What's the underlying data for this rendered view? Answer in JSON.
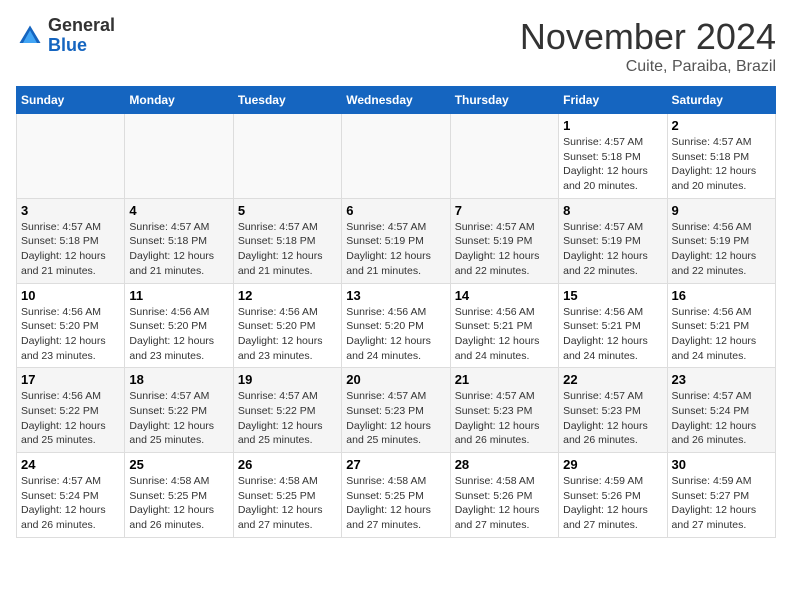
{
  "logo": {
    "general": "General",
    "blue": "Blue"
  },
  "header": {
    "month": "November 2024",
    "location": "Cuite, Paraiba, Brazil"
  },
  "weekdays": [
    "Sunday",
    "Monday",
    "Tuesday",
    "Wednesday",
    "Thursday",
    "Friday",
    "Saturday"
  ],
  "weeks": [
    [
      {
        "day": "",
        "info": ""
      },
      {
        "day": "",
        "info": ""
      },
      {
        "day": "",
        "info": ""
      },
      {
        "day": "",
        "info": ""
      },
      {
        "day": "",
        "info": ""
      },
      {
        "day": "1",
        "info": "Sunrise: 4:57 AM\nSunset: 5:18 PM\nDaylight: 12 hours\nand 20 minutes."
      },
      {
        "day": "2",
        "info": "Sunrise: 4:57 AM\nSunset: 5:18 PM\nDaylight: 12 hours\nand 20 minutes."
      }
    ],
    [
      {
        "day": "3",
        "info": "Sunrise: 4:57 AM\nSunset: 5:18 PM\nDaylight: 12 hours\nand 21 minutes."
      },
      {
        "day": "4",
        "info": "Sunrise: 4:57 AM\nSunset: 5:18 PM\nDaylight: 12 hours\nand 21 minutes."
      },
      {
        "day": "5",
        "info": "Sunrise: 4:57 AM\nSunset: 5:18 PM\nDaylight: 12 hours\nand 21 minutes."
      },
      {
        "day": "6",
        "info": "Sunrise: 4:57 AM\nSunset: 5:19 PM\nDaylight: 12 hours\nand 21 minutes."
      },
      {
        "day": "7",
        "info": "Sunrise: 4:57 AM\nSunset: 5:19 PM\nDaylight: 12 hours\nand 22 minutes."
      },
      {
        "day": "8",
        "info": "Sunrise: 4:57 AM\nSunset: 5:19 PM\nDaylight: 12 hours\nand 22 minutes."
      },
      {
        "day": "9",
        "info": "Sunrise: 4:56 AM\nSunset: 5:19 PM\nDaylight: 12 hours\nand 22 minutes."
      }
    ],
    [
      {
        "day": "10",
        "info": "Sunrise: 4:56 AM\nSunset: 5:20 PM\nDaylight: 12 hours\nand 23 minutes."
      },
      {
        "day": "11",
        "info": "Sunrise: 4:56 AM\nSunset: 5:20 PM\nDaylight: 12 hours\nand 23 minutes."
      },
      {
        "day": "12",
        "info": "Sunrise: 4:56 AM\nSunset: 5:20 PM\nDaylight: 12 hours\nand 23 minutes."
      },
      {
        "day": "13",
        "info": "Sunrise: 4:56 AM\nSunset: 5:20 PM\nDaylight: 12 hours\nand 24 minutes."
      },
      {
        "day": "14",
        "info": "Sunrise: 4:56 AM\nSunset: 5:21 PM\nDaylight: 12 hours\nand 24 minutes."
      },
      {
        "day": "15",
        "info": "Sunrise: 4:56 AM\nSunset: 5:21 PM\nDaylight: 12 hours\nand 24 minutes."
      },
      {
        "day": "16",
        "info": "Sunrise: 4:56 AM\nSunset: 5:21 PM\nDaylight: 12 hours\nand 24 minutes."
      }
    ],
    [
      {
        "day": "17",
        "info": "Sunrise: 4:56 AM\nSunset: 5:22 PM\nDaylight: 12 hours\nand 25 minutes."
      },
      {
        "day": "18",
        "info": "Sunrise: 4:57 AM\nSunset: 5:22 PM\nDaylight: 12 hours\nand 25 minutes."
      },
      {
        "day": "19",
        "info": "Sunrise: 4:57 AM\nSunset: 5:22 PM\nDaylight: 12 hours\nand 25 minutes."
      },
      {
        "day": "20",
        "info": "Sunrise: 4:57 AM\nSunset: 5:23 PM\nDaylight: 12 hours\nand 25 minutes."
      },
      {
        "day": "21",
        "info": "Sunrise: 4:57 AM\nSunset: 5:23 PM\nDaylight: 12 hours\nand 26 minutes."
      },
      {
        "day": "22",
        "info": "Sunrise: 4:57 AM\nSunset: 5:23 PM\nDaylight: 12 hours\nand 26 minutes."
      },
      {
        "day": "23",
        "info": "Sunrise: 4:57 AM\nSunset: 5:24 PM\nDaylight: 12 hours\nand 26 minutes."
      }
    ],
    [
      {
        "day": "24",
        "info": "Sunrise: 4:57 AM\nSunset: 5:24 PM\nDaylight: 12 hours\nand 26 minutes."
      },
      {
        "day": "25",
        "info": "Sunrise: 4:58 AM\nSunset: 5:25 PM\nDaylight: 12 hours\nand 26 minutes."
      },
      {
        "day": "26",
        "info": "Sunrise: 4:58 AM\nSunset: 5:25 PM\nDaylight: 12 hours\nand 27 minutes."
      },
      {
        "day": "27",
        "info": "Sunrise: 4:58 AM\nSunset: 5:25 PM\nDaylight: 12 hours\nand 27 minutes."
      },
      {
        "day": "28",
        "info": "Sunrise: 4:58 AM\nSunset: 5:26 PM\nDaylight: 12 hours\nand 27 minutes."
      },
      {
        "day": "29",
        "info": "Sunrise: 4:59 AM\nSunset: 5:26 PM\nDaylight: 12 hours\nand 27 minutes."
      },
      {
        "day": "30",
        "info": "Sunrise: 4:59 AM\nSunset: 5:27 PM\nDaylight: 12 hours\nand 27 minutes."
      }
    ]
  ]
}
